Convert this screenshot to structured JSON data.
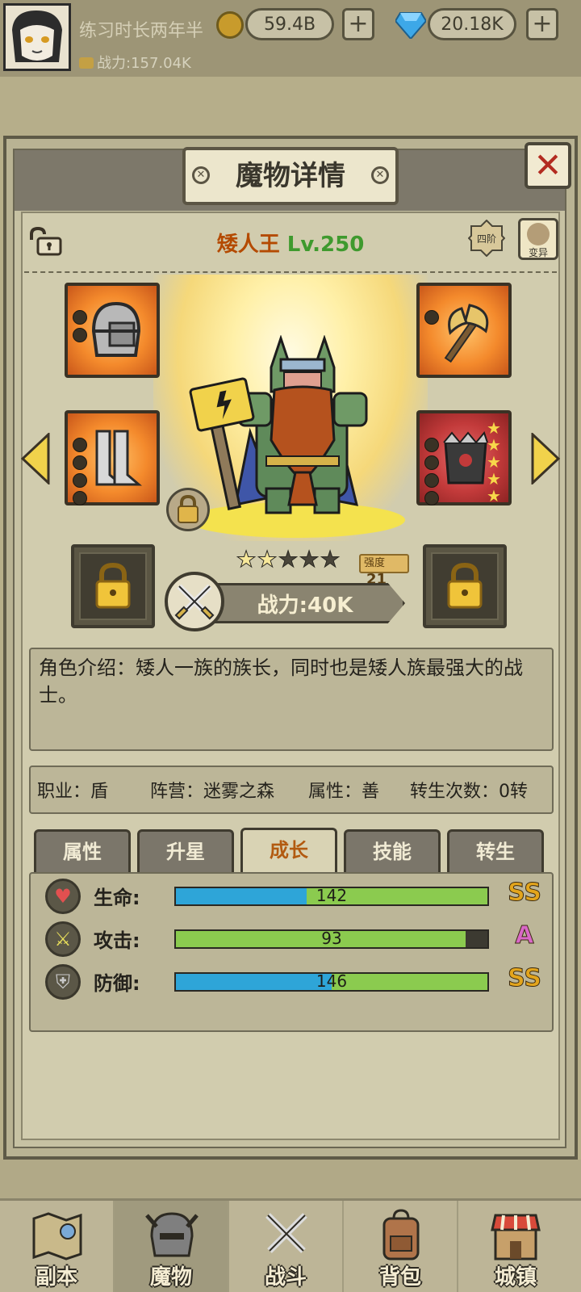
{
  "topbar": {
    "player_name": "练习时长两年半",
    "gold": "59.4B",
    "gems": "20.18K",
    "power_label": "战力:157.04K"
  },
  "panel": {
    "title": "魔物详情",
    "close_label": "✕",
    "rank_label": "四阶",
    "mutate_label": "变异"
  },
  "monster": {
    "name": "矮人王",
    "level": "Lv.250",
    "stars_filled": 2,
    "stars_total": 5,
    "strength_label": "强度",
    "strength_value": "21",
    "power": "战力:40K",
    "description": "角色介绍：矮人一族的族长，同时也是矮人族最强大的战士。",
    "job": "职业：盾",
    "faction": "阵营：迷雾之森",
    "attribute": "属性：善",
    "rebirth": "转生次数：0转"
  },
  "tabs": [
    {
      "label": "属性"
    },
    {
      "label": "升星"
    },
    {
      "label": "成长"
    },
    {
      "label": "技能"
    },
    {
      "label": "转生"
    }
  ],
  "stats": [
    {
      "label": "生命:",
      "value": "142",
      "grade": "SS",
      "blue_fill": 0.42,
      "green_fill": 1.0,
      "grade_color": "#e3a51c"
    },
    {
      "label": "攻击:",
      "value": "93",
      "grade": "A",
      "blue_fill": 0.0,
      "green_fill": 0.93,
      "grade_color": "#d968c7"
    },
    {
      "label": "防御:",
      "value": "146",
      "grade": "SS",
      "blue_fill": 0.5,
      "green_fill": 1.0,
      "grade_color": "#e3a51c"
    }
  ],
  "nav": [
    {
      "label": "副本",
      "icon": "map-icon"
    },
    {
      "label": "魔物",
      "icon": "helmet-icon"
    },
    {
      "label": "战斗",
      "icon": "crossed-swords-icon"
    },
    {
      "label": "背包",
      "icon": "backpack-icon"
    },
    {
      "label": "城镇",
      "icon": "shop-icon"
    }
  ],
  "colors": {
    "accent_orange": "#b44a00",
    "level_green": "#3f9a2e",
    "bar_blue": "#2ea5d8",
    "bar_green": "#8bcb4f",
    "close_red": "#b32b20"
  }
}
